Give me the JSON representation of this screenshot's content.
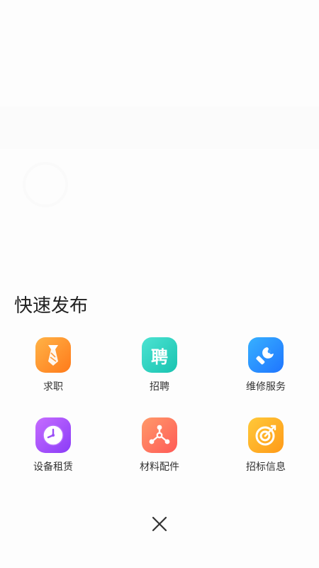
{
  "panel": {
    "title": "快速发布"
  },
  "items": [
    {
      "label": "求职",
      "icon": "tie-icon",
      "color": "#ff8c2a"
    },
    {
      "label": "招聘",
      "icon": "hire-icon",
      "icon_text": "聘",
      "color": "#22cdb9"
    },
    {
      "label": "维修服务",
      "icon": "wrench-icon",
      "color": "#2a8cff"
    },
    {
      "label": "设备租赁",
      "icon": "clock-icon",
      "color": "#a24cfb"
    },
    {
      "label": "材料配件",
      "icon": "network-icon",
      "color": "#ff6b5c"
    },
    {
      "label": "招标信息",
      "icon": "target-icon",
      "color": "#ffae25"
    }
  ],
  "close": {
    "icon": "close-icon"
  }
}
